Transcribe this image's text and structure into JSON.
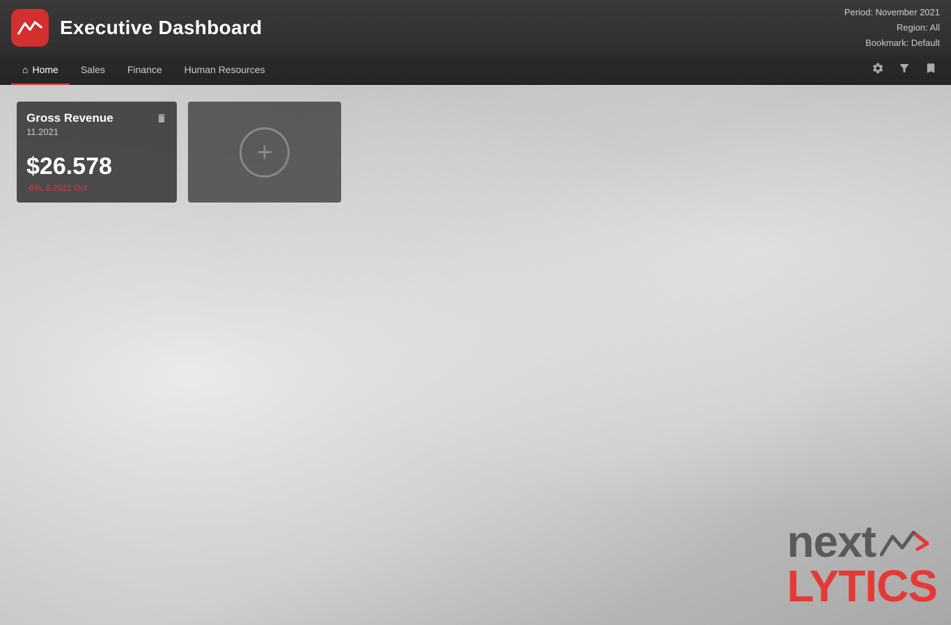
{
  "header": {
    "title": "Executive Dashboard",
    "period": "Period: November 2021",
    "region": "Region: All",
    "bookmark": "Bookmark: Default",
    "logo_alt": "NextAnalytics logo"
  },
  "navbar": {
    "items": [
      {
        "label": "Home",
        "id": "home",
        "active": true,
        "has_icon": true
      },
      {
        "label": "Sales",
        "id": "sales",
        "active": false,
        "has_icon": false
      },
      {
        "label": "Finance",
        "id": "finance",
        "active": false,
        "has_icon": false
      },
      {
        "label": "Human Resources",
        "id": "hr",
        "active": false,
        "has_icon": false
      }
    ],
    "icons": [
      {
        "id": "settings",
        "label": "settings-icon"
      },
      {
        "id": "filter",
        "label": "filter-icon"
      },
      {
        "id": "bookmark",
        "label": "bookmark-icon"
      }
    ]
  },
  "kpi_card": {
    "title": "Gross Revenue",
    "period": "11.2021",
    "value": "$26.578",
    "change": "-6%, Δ 2021 Oct",
    "delete_tooltip": "Delete"
  },
  "add_card": {
    "label": "Add KPI"
  },
  "brand": {
    "next": "next",
    "lytics": "LYTiCS"
  }
}
